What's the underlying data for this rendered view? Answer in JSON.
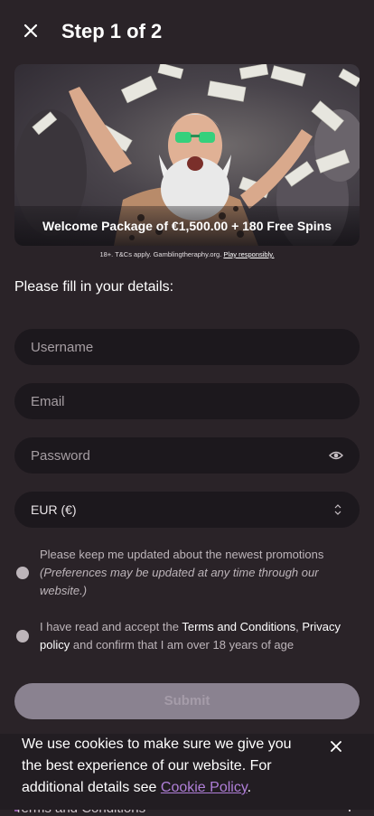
{
  "header": {
    "title": "Step 1 of 2",
    "close_icon": "close-icon"
  },
  "banner": {
    "caption": "Welcome Package of €1,500.00 + 180 Free Spins",
    "image": "celebrating bearded man in sunglasses with flying banknotes"
  },
  "disclaimer": {
    "text": "18+. T&Cs apply. Gamblingtheraphy.org.",
    "link": "Play responsibly."
  },
  "form": {
    "prompt": "Please fill in your details:",
    "username_placeholder": "Username",
    "email_placeholder": "Email",
    "password_placeholder": "Password",
    "currency_value": "EUR (€)",
    "promo_line1": "Please keep me updated about the newest promotions",
    "promo_line2": "(Preferences may be updated at any time through our website.)",
    "terms_prefix": "I have read and accept the",
    "terms_link": "Terms and Conditions",
    "terms_comma": ",",
    "privacy_link": "Privacy policy",
    "terms_suffix": "and confirm that I am over 18 years of age",
    "submit_label": "Submit"
  },
  "underlay": {
    "text": "Terms and Conditions"
  },
  "cookie": {
    "text": "We use cookies to make sure we give you the best experience of our website. For additional details see",
    "link": "Cookie Policy",
    "period": "."
  },
  "colors": {
    "background": "#2a2328",
    "field": "#1c181d",
    "submit": "#8a8290",
    "link_purple": "#b07fd8"
  }
}
